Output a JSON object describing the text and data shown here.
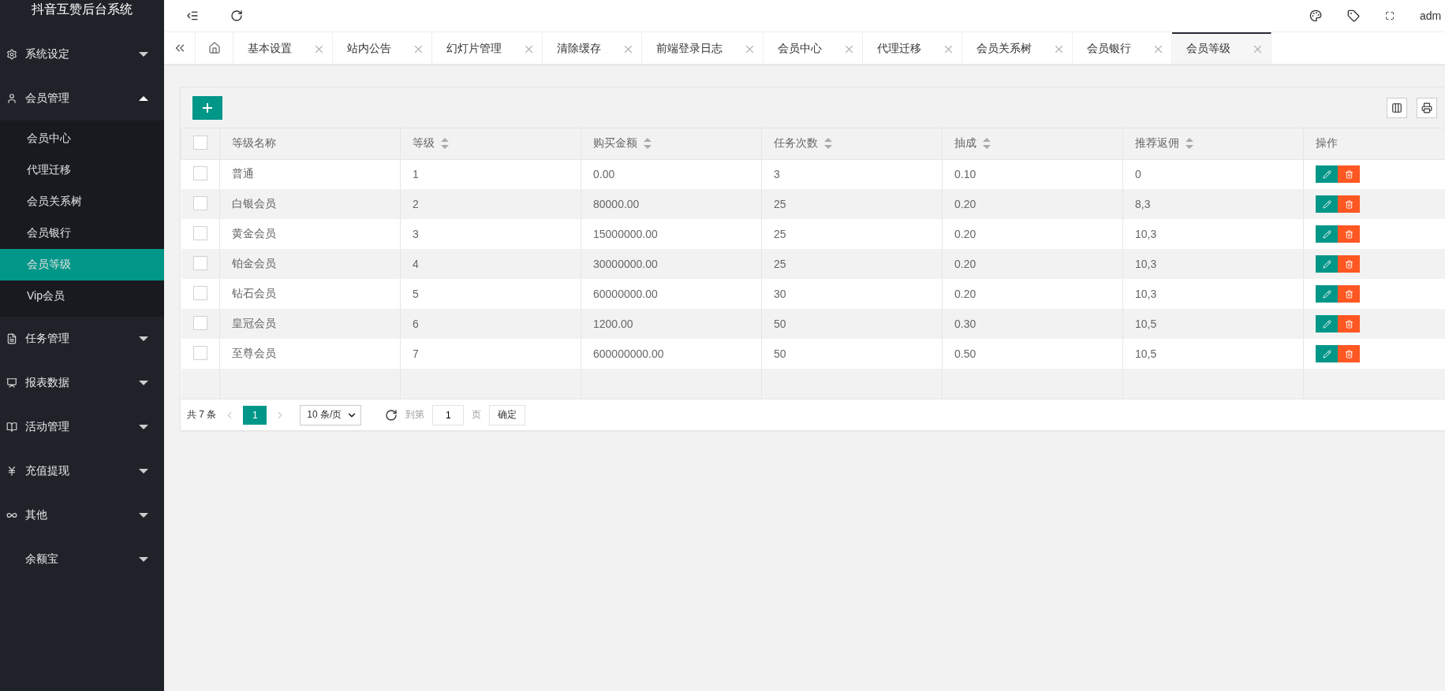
{
  "sidebar": {
    "title": "抖音互赞后台系统",
    "items": [
      {
        "label": "系统设定",
        "expanded": false
      },
      {
        "label": "会员管理",
        "expanded": true,
        "children": [
          {
            "label": "会员中心",
            "selected": false
          },
          {
            "label": "代理迁移",
            "selected": false
          },
          {
            "label": "会员关系树",
            "selected": false
          },
          {
            "label": "会员银行",
            "selected": false
          },
          {
            "label": "会员等级",
            "selected": true
          },
          {
            "label": "Vip会员",
            "selected": false
          }
        ]
      },
      {
        "label": "任务管理",
        "expanded": false
      },
      {
        "label": "报表数据",
        "expanded": false
      },
      {
        "label": "活动管理",
        "expanded": false
      },
      {
        "label": "充值提现",
        "expanded": false
      },
      {
        "label": "其他",
        "expanded": false
      },
      {
        "label": "余额宝",
        "expanded": false
      }
    ]
  },
  "topbar": {
    "user": "adm"
  },
  "tabs": [
    {
      "label": "基本设置",
      "selected": false
    },
    {
      "label": "站内公告",
      "selected": false
    },
    {
      "label": "幻灯片管理",
      "selected": false
    },
    {
      "label": "清除缓存",
      "selected": false
    },
    {
      "label": "前端登录日志",
      "selected": false
    },
    {
      "label": "会员中心",
      "selected": false
    },
    {
      "label": "代理迁移",
      "selected": false
    },
    {
      "label": "会员关系树",
      "selected": false
    },
    {
      "label": "会员银行",
      "selected": false
    },
    {
      "label": "会员等级",
      "selected": true
    }
  ],
  "table": {
    "all_checked": false,
    "columns": [
      {
        "label": "等级名称",
        "sortable": false
      },
      {
        "label": "等级",
        "sortable": true
      },
      {
        "label": "购买金额",
        "sortable": true
      },
      {
        "label": "任务次数",
        "sortable": true
      },
      {
        "label": "抽成",
        "sortable": true
      },
      {
        "label": "推荐返佣",
        "sortable": true
      },
      {
        "label": "操作",
        "sortable": false
      }
    ],
    "rows": [
      {
        "checked": false,
        "cells": [
          "普通",
          "1",
          "0.00",
          "3",
          "0.10",
          "0"
        ]
      },
      {
        "checked": false,
        "cells": [
          "白银会员",
          "2",
          "80000.00",
          "25",
          "0.20",
          "8,3"
        ]
      },
      {
        "checked": false,
        "cells": [
          "黄金会员",
          "3",
          "15000000.00",
          "25",
          "0.20",
          "10,3"
        ]
      },
      {
        "checked": false,
        "cells": [
          "铂金会员",
          "4",
          "30000000.00",
          "25",
          "0.20",
          "10,3"
        ]
      },
      {
        "checked": false,
        "cells": [
          "钻石会员",
          "5",
          "60000000.00",
          "30",
          "0.20",
          "10,3"
        ]
      },
      {
        "checked": false,
        "cells": [
          "皇冠会员",
          "6",
          "1200.00",
          "50",
          "0.30",
          "10,5"
        ]
      },
      {
        "checked": false,
        "cells": [
          "至尊会员",
          "7",
          "600000000.00",
          "50",
          "0.50",
          "10,5"
        ]
      }
    ]
  },
  "pager": {
    "total": "共 7 条",
    "pages": [
      {
        "label": "1",
        "selected": true
      }
    ],
    "page_size": "10 条/页",
    "goto_label": "到第",
    "goto_value": "1",
    "page_unit": "页",
    "confirm": "确定"
  }
}
